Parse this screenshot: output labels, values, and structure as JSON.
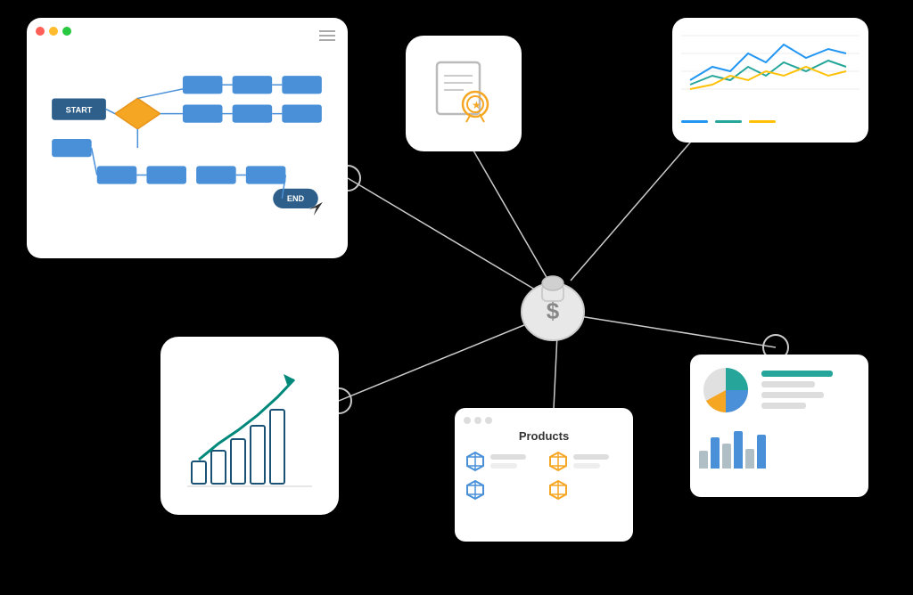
{
  "flowchart": {
    "title": "Flowchart",
    "start_label": "START",
    "end_label": "END"
  },
  "certificate": {
    "title": "Certificate"
  },
  "linechart": {
    "title": "Line Chart",
    "colors": [
      "#2196f3",
      "#4caf50",
      "#ffc107"
    ]
  },
  "growth": {
    "title": "Growth Chart"
  },
  "products": {
    "title": "Products",
    "dots": [
      "gray",
      "gray",
      "gray"
    ],
    "items": [
      {
        "type": "box",
        "color": "blue"
      },
      {
        "type": "box",
        "color": "yellow"
      },
      {
        "type": "box",
        "color": "blue"
      },
      {
        "type": "box",
        "color": "yellow"
      }
    ]
  },
  "analytics": {
    "title": "Analytics"
  },
  "moneybag": {
    "symbol": "$"
  }
}
